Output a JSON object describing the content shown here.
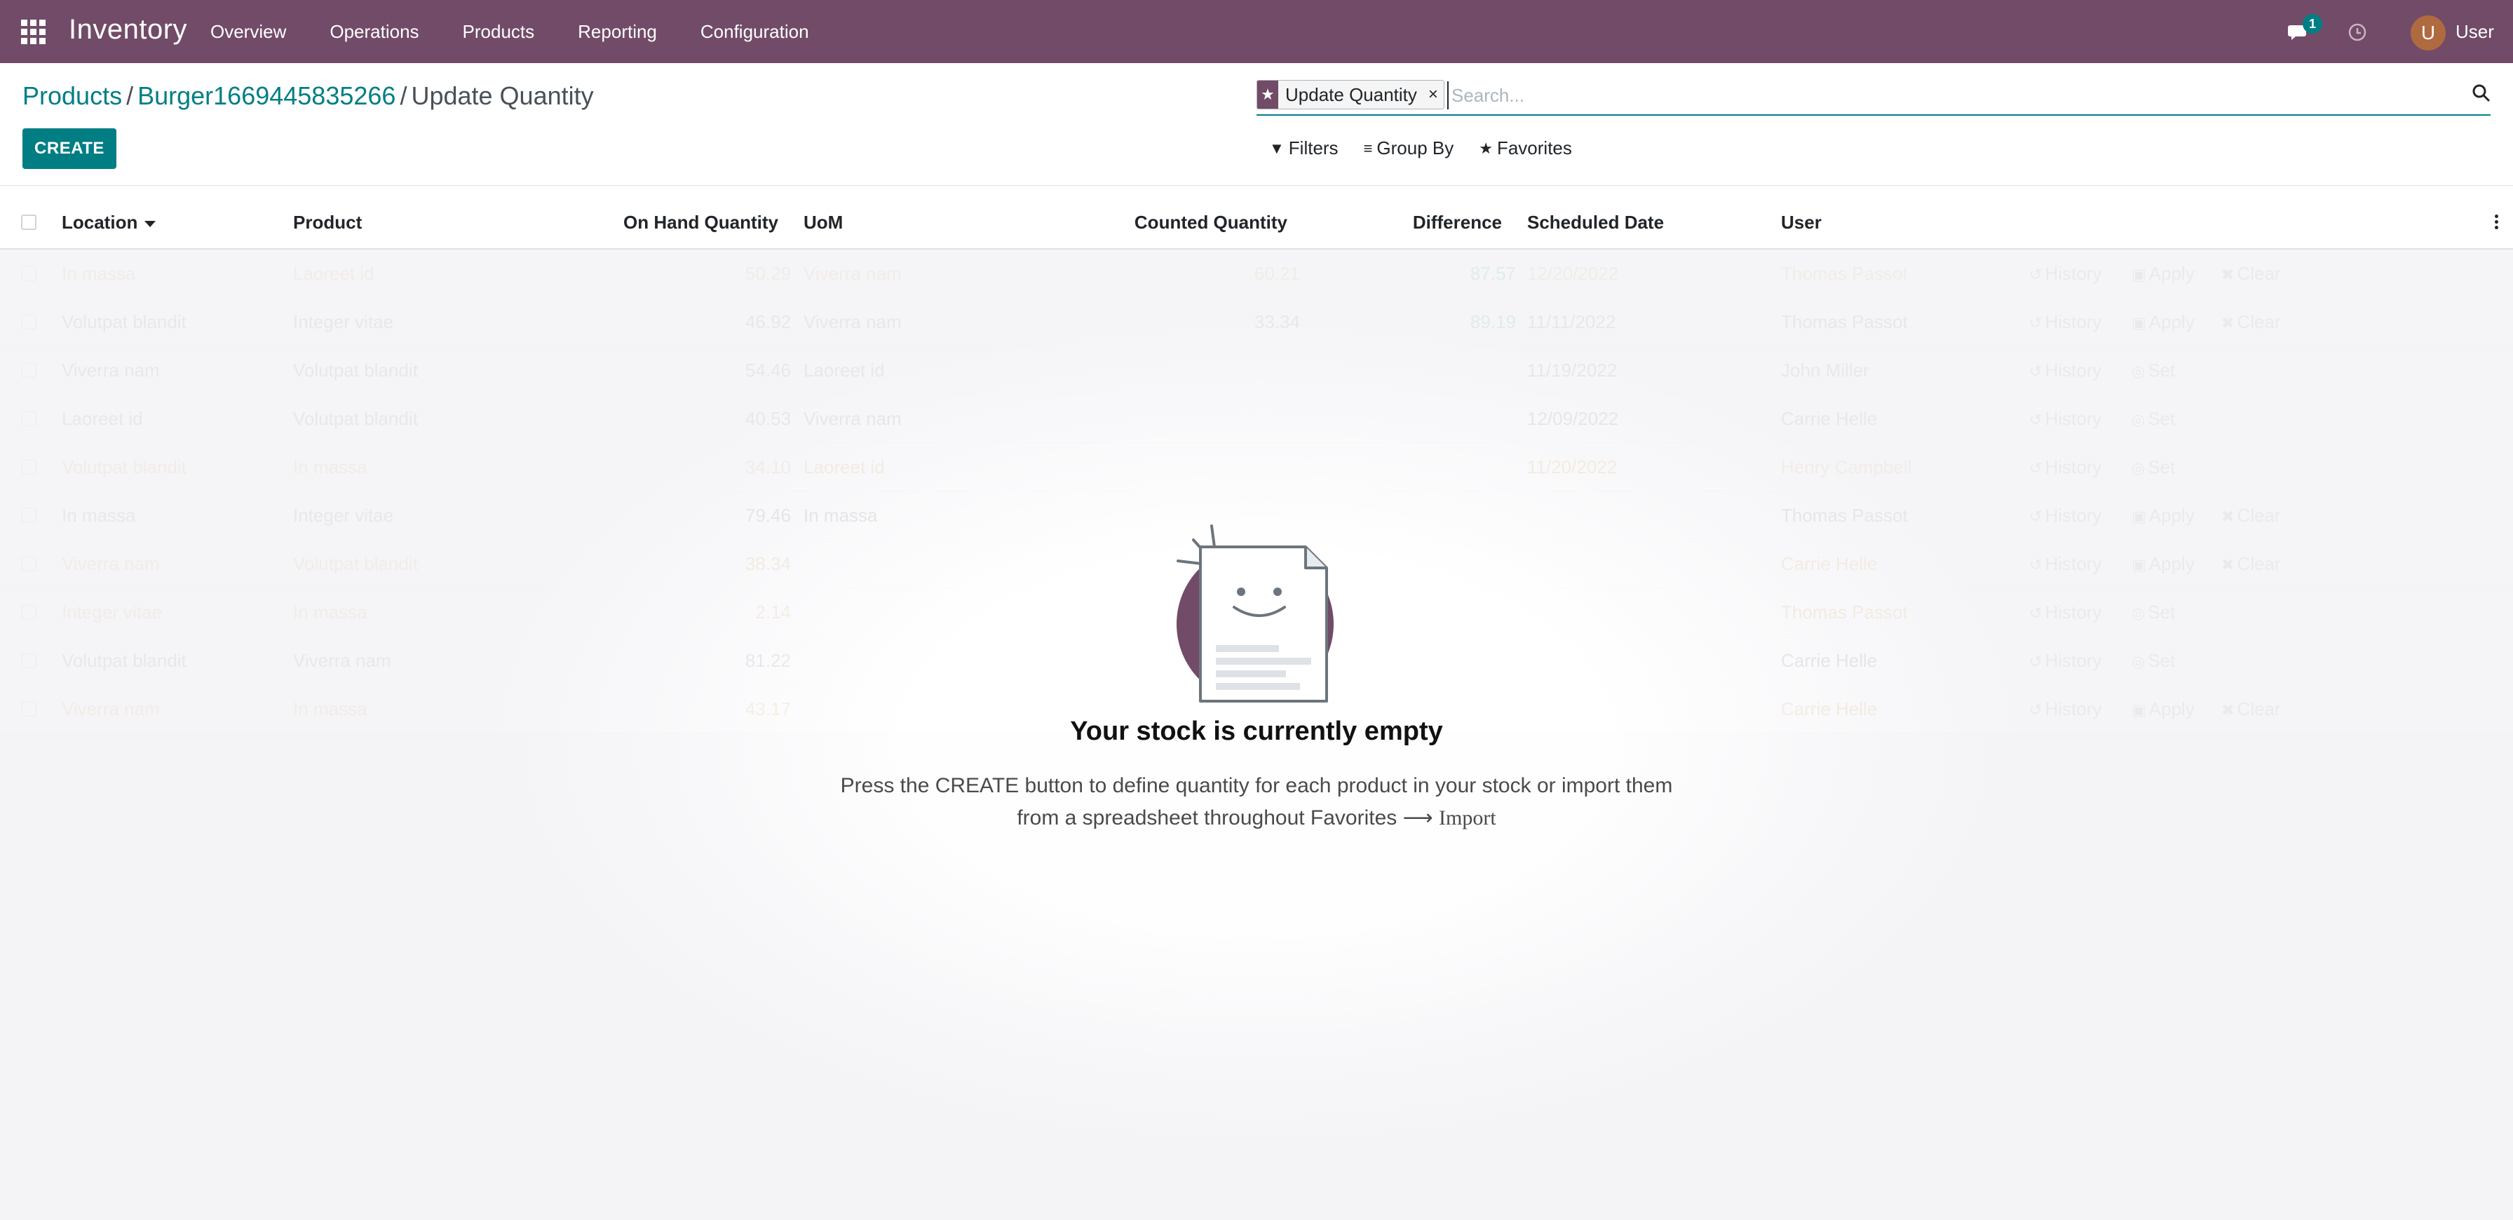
{
  "navbar": {
    "brand": "Inventory",
    "menu": [
      "Overview",
      "Operations",
      "Products",
      "Reporting",
      "Configuration"
    ],
    "chat_count": "1",
    "user_initial": "U",
    "user_name": "User",
    "bg_color": "#714b67"
  },
  "breadcrumb": {
    "items": [
      "Products",
      "Burger1669445835266"
    ],
    "separator": "/",
    "current": "Update Quantity"
  },
  "create_label": "CREATE",
  "search": {
    "facet_label": "Update Quantity",
    "facet_remove": "×",
    "placeholder": "Search...",
    "filters": "Filters",
    "group_by": "Group By",
    "favorites": "Favorites"
  },
  "table": {
    "headers": {
      "location": "Location",
      "product": "Product",
      "on_hand": "On Hand Quantity",
      "uom": "UoM",
      "counted": "Counted Quantity",
      "difference": "Difference",
      "scheduled": "Scheduled Date",
      "user": "User"
    },
    "actions": {
      "history": "History",
      "apply": "Apply",
      "clear": "Clear",
      "set": "Set"
    },
    "rows": [
      {
        "location": "In massa",
        "product": "Laoreet id",
        "on_hand": "50.29",
        "uom": "Viverra nam",
        "counted": "60.21",
        "difference": "87.57",
        "date": "12/20/2022",
        "user": "Thomas Passot",
        "style": "warn",
        "mode": "apply"
      },
      {
        "location": "Volutpat blandit",
        "product": "Integer vitae",
        "on_hand": "46.92",
        "uom": "Viverra nam",
        "counted": "33.34",
        "difference": "89.19",
        "date": "11/11/2022",
        "user": "Thomas Passot",
        "style": "norm",
        "mode": "apply"
      },
      {
        "location": "Viverra nam",
        "product": "Volutpat blandit",
        "on_hand": "54.46",
        "uom": "Laoreet id",
        "counted": "",
        "difference": "",
        "date": "11/19/2022",
        "user": "John Miller",
        "style": "norm",
        "mode": "set"
      },
      {
        "location": "Laoreet id",
        "product": "Volutpat blandit",
        "on_hand": "40.53",
        "uom": "Viverra nam",
        "counted": "",
        "difference": "",
        "date": "12/09/2022",
        "user": "Carrie Helle",
        "style": "norm",
        "mode": "set"
      },
      {
        "location": "Volutpat blandit",
        "product": "In massa",
        "on_hand": "34.10",
        "uom": "Laoreet id",
        "counted": "",
        "difference": "",
        "date": "11/20/2022",
        "user": "Henry Campbell",
        "style": "warn",
        "mode": "set"
      },
      {
        "location": "In massa",
        "product": "Integer vitae",
        "on_hand": "79.46",
        "uom": "In massa",
        "counted": "",
        "difference": "",
        "date": "",
        "user": "Thomas Passot",
        "style": "norm",
        "mode": "apply"
      },
      {
        "location": "Viverra nam",
        "product": "Volutpat blandit",
        "on_hand": "38.34",
        "uom": "",
        "counted": "",
        "difference": "",
        "date": "",
        "user": "Carrie Helle",
        "style": "warn",
        "mode": "apply"
      },
      {
        "location": "Integer vitae",
        "product": "In massa",
        "on_hand": "2.14",
        "uom": "",
        "counted": "",
        "difference": "",
        "date": "",
        "user": "Thomas Passot",
        "style": "warn",
        "mode": "set"
      },
      {
        "location": "Volutpat blandit",
        "product": "Viverra nam",
        "on_hand": "81.22",
        "uom": "",
        "counted": "",
        "difference": "",
        "date": "",
        "user": "Carrie Helle",
        "style": "norm",
        "mode": "set"
      },
      {
        "location": "Viverra nam",
        "product": "In massa",
        "on_hand": "43.17",
        "uom": "",
        "counted": "",
        "difference": "",
        "date": "",
        "user": "Carrie Helle",
        "style": "warn",
        "mode": "apply"
      }
    ]
  },
  "empty_state": {
    "title": "Your stock is currently empty",
    "line1": "Press the CREATE button to define quantity for each product in your stock or import them",
    "line2": "from a spreadsheet throughout Favorites",
    "arrow": "⟶",
    "import": "Import"
  }
}
